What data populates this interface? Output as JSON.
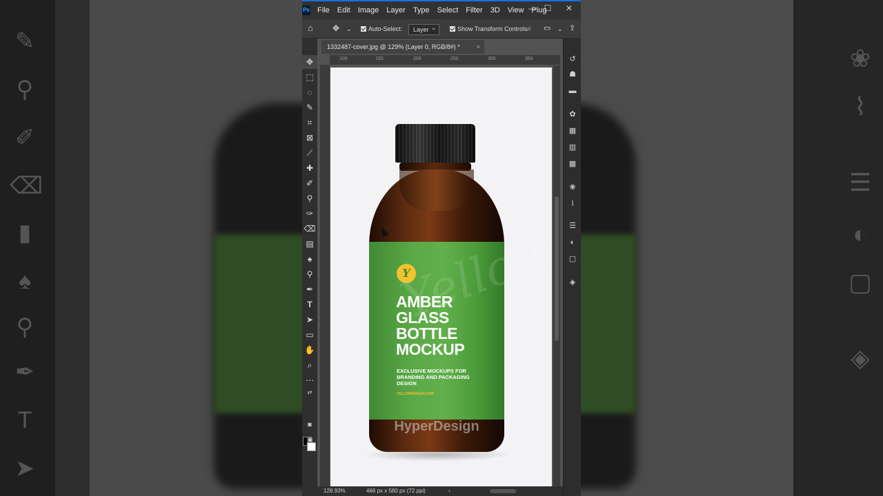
{
  "menu": [
    "File",
    "Edit",
    "Image",
    "Layer",
    "Type",
    "Select",
    "Filter",
    "3D",
    "View",
    "Plug"
  ],
  "window_controls": {
    "minimize": "—",
    "maximize": "☐",
    "close": "✕"
  },
  "options_bar": {
    "auto_select_label": "Auto-Select:",
    "auto_select_value": "Layer",
    "transform_label": "Show Transform Controls"
  },
  "document_tab": {
    "title": "1332487-cover.jpg @ 129% (Layer 0, RGB/8#) *",
    "close": "×"
  },
  "ruler_top": [
    "100",
    "150",
    "200",
    "250",
    "300",
    "350"
  ],
  "status_bar": {
    "zoom": "128.93%",
    "info": "466 px x 580 px (72 ppi)",
    "arrow": "›"
  },
  "product": {
    "logo": "Y",
    "title": "AMBER GLASS BOTTLE MOCKUP",
    "subtitle": "EXCLUSIVE MOCKUPS FOR BRANDING AND PACKAGING DESIGN",
    "site": "YELLOWIMAGES.COM",
    "script": "Yellow",
    "watermark": "HyperDesign"
  },
  "colors": {
    "ps_bg": "#535353",
    "panel_dark": "#2f2f2f",
    "accent_blue": "#1473e6",
    "label_green": "#5aa746",
    "amber": "#5a2a10"
  }
}
